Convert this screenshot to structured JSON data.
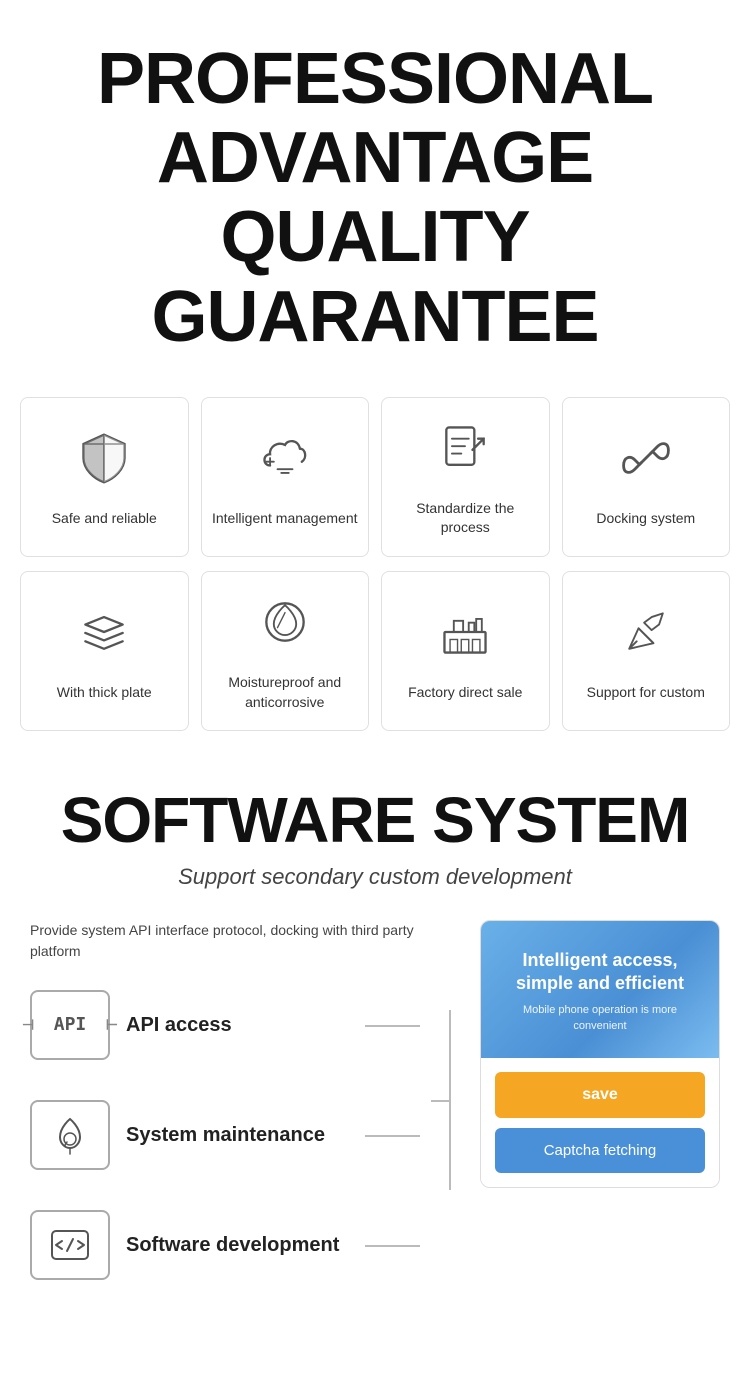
{
  "header": {
    "line1": "PROFESSIONAL",
    "line2": "ADVANTAGE",
    "line3": "QUALITY GUARANTEE"
  },
  "features_row1": [
    {
      "id": "safe-reliable",
      "label": "Safe and reliable",
      "icon": "shield"
    },
    {
      "id": "intelligent-management",
      "label": "Intelligent management",
      "icon": "cloud-settings"
    },
    {
      "id": "standardize-process",
      "label": "Standardize the process",
      "icon": "document-arrow"
    },
    {
      "id": "docking-system",
      "label": "Docking system",
      "icon": "link"
    }
  ],
  "features_row2": [
    {
      "id": "thick-plate",
      "label": "With thick plate",
      "icon": "layers"
    },
    {
      "id": "moistureproof",
      "label": "Moistureproof and anticorrosive",
      "icon": "leaf-drop"
    },
    {
      "id": "factory-direct",
      "label": "Factory direct sale",
      "icon": "factory"
    },
    {
      "id": "support-custom",
      "label": "Support for custom",
      "icon": "pen-wrench"
    }
  ],
  "software": {
    "title": "SOFTWARE SYSTEM",
    "subtitle": "Support secondary custom development",
    "description": "Provide system API interface protocol, docking with third party platform",
    "items": [
      {
        "id": "api-access",
        "label": "API access",
        "icon": "api"
      },
      {
        "id": "system-maintenance",
        "label": "System maintenance",
        "icon": "drop-wrench"
      },
      {
        "id": "software-development",
        "label": "Software development",
        "icon": "code"
      }
    ],
    "panel": {
      "main_text": "Intelligent access, simple and efficient",
      "sub_text": "Mobile phone operation is more convenient",
      "save_btn": "save",
      "captcha_btn": "Captcha fetching"
    }
  }
}
